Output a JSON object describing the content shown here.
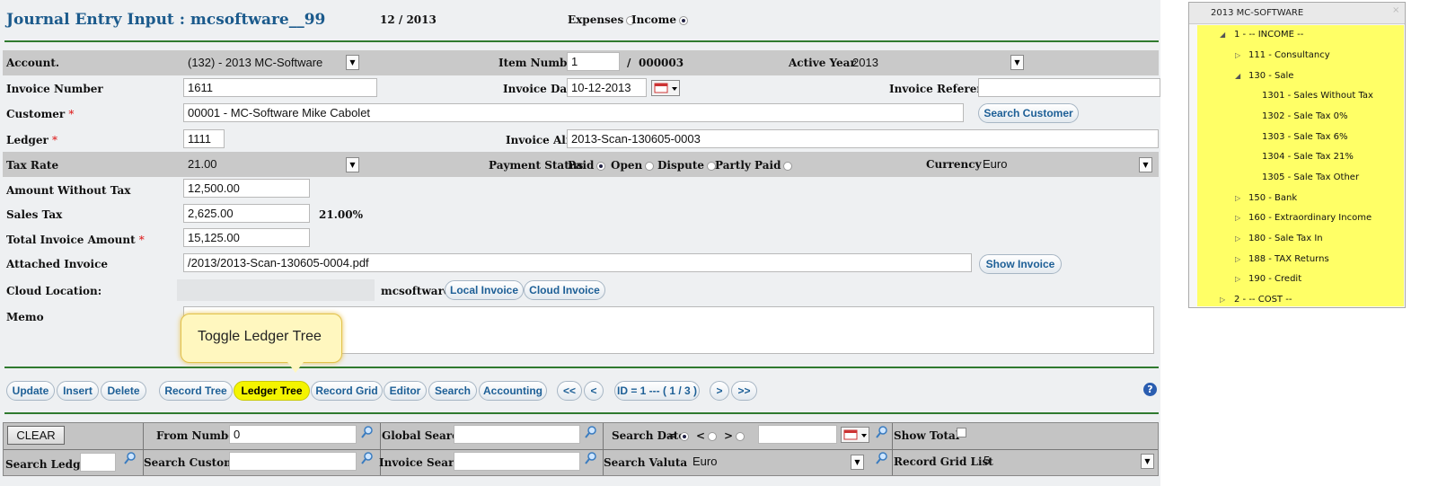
{
  "header": {
    "title": "Journal Entry Input : mcsoftware__99",
    "period": "12 / 2013",
    "expenses_label": "Expenses",
    "income_label": "Income"
  },
  "form": {
    "account_label": "Account.",
    "account_value": "(132) - 2013 MC-Software",
    "item_number_label": "Item Number",
    "item_number_value": "1",
    "item_number_sep": "/",
    "item_number_total": "000003",
    "active_year_label": "Active Year",
    "active_year_value": "2013",
    "invoice_number_label": "Invoice Number",
    "invoice_number_value": "1611",
    "invoice_date_label": "Invoice Date",
    "invoice_date_value": "10-12-2013",
    "invoice_reference_label": "Invoice Reference",
    "invoice_reference_value": "",
    "customer_label": "Customer",
    "customer_value": "00001 - MC-Software Mike Cabolet",
    "search_customer_label": "Search Customer",
    "ledger_label": "Ledger",
    "ledger_value": "1111",
    "invoice_alias_label": "Invoice Alias",
    "invoice_alias_value": "2013-Scan-130605-0003",
    "tax_rate_label": "Tax Rate",
    "tax_rate_value": "21.00",
    "payment_status_label": "Payment Status",
    "payment_options": [
      "Paid",
      "Open",
      "Dispute",
      "Partly Paid"
    ],
    "currency_label": "Currency",
    "currency_value": "Euro",
    "amount_without_tax_label": "Amount Without Tax",
    "amount_without_tax_value": "12,500.00",
    "sales_tax_label": "Sales Tax",
    "sales_tax_value": "2,625.00",
    "sales_tax_pct": "21.00%",
    "total_invoice_label": "Total Invoice Amount",
    "total_invoice_value": "15,125.00",
    "attached_invoice_label": "Attached Invoice",
    "attached_invoice_value": "/2013/2013-Scan-130605-0004.pdf",
    "show_invoice_label": "Show Invoice",
    "cloud_location_label": "Cloud Location:",
    "cloud_location_value": "mcsoftware",
    "local_invoice_label": "Local Invoice",
    "cloud_invoice_label": "Cloud Invoice",
    "memo_label": "Memo",
    "required_mark": "*"
  },
  "tooltip": {
    "text": "Toggle Ledger Tree"
  },
  "toolbar": {
    "update": "Update",
    "insert": "Insert",
    "delete": "Delete",
    "record_tree": "Record Tree",
    "ledger_tree": "Ledger Tree",
    "record_grid": "Record Grid",
    "editor": "Editor",
    "search": "Search",
    "accounting": "Accounting",
    "first": "<<",
    "prev": "<",
    "record_id": "ID = 1 --- ( 1 / 3 )",
    "next": ">",
    "last": ">>",
    "help": "?"
  },
  "search_grid": {
    "clear": "CLEAR",
    "from_number_label": "From Number",
    "from_number_value": "0",
    "global_search_label": "Global Search",
    "search_date_label": "Search Date",
    "date_ops": [
      "=",
      "<",
      ">"
    ],
    "show_total_label": "Show Total",
    "search_ledger_label": "Search Ledger",
    "search_customer_label": "Search Customer",
    "invoice_search_label": "Invoice Search",
    "search_valuta_label": "Search Valuta",
    "valuta_value": "Euro",
    "record_grid_list_label": "Record Grid List",
    "record_grid_list_value": "5"
  },
  "tree": {
    "title": "2013 MC-SOFTWARE",
    "nodes": [
      "1 - -- INCOME --",
      "111 - Consultancy",
      "130 - Sale",
      "1301 - Sales Without Tax",
      "1302 - Sale Tax 0%",
      "1303 - Sale Tax 6%",
      "1304 - Sale Tax 21%",
      "1305 - Sale Tax Other",
      "150 - Bank",
      "160 - Extraordinary Income",
      "180 - Sale Tax In",
      "188 - TAX Returns",
      "190 - Credit",
      "2 - -- COST --"
    ]
  },
  "colors": {
    "title_blue": "#1b5a8c",
    "tree_highlight": "#ffff66",
    "ledger_button": "#f4f400",
    "divider_green": "#2f7a2f"
  }
}
